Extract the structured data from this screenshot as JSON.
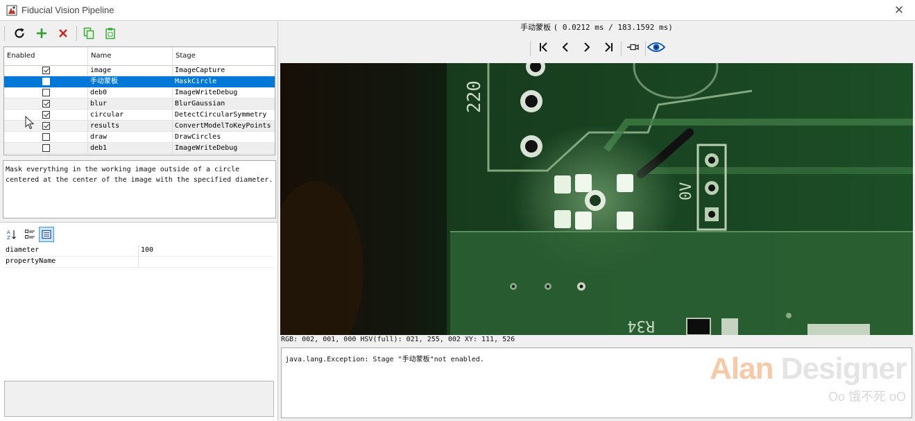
{
  "window": {
    "title": "Fiducial Vision Pipeline",
    "close_glyph": "✕"
  },
  "toolbar": {
    "icons": [
      "refresh-icon",
      "add-icon",
      "delete-icon",
      "copy-icon",
      "paste-icon"
    ]
  },
  "table": {
    "headers": {
      "enabled": "Enabled",
      "name": "Name",
      "stage": "Stage"
    },
    "rows": [
      {
        "enabled": true,
        "name": "image",
        "stage": "ImageCapture"
      },
      {
        "enabled": false,
        "name": "手动蒙板",
        "stage": "MaskCircle"
      },
      {
        "enabled": false,
        "name": "deb0",
        "stage": "ImageWriteDebug"
      },
      {
        "enabled": true,
        "name": "blur",
        "stage": "BlurGaussian"
      },
      {
        "enabled": true,
        "name": "circular",
        "stage": "DetectCircularSymmetry"
      },
      {
        "enabled": true,
        "name": "results",
        "stage": "ConvertModelToKeyPoints"
      },
      {
        "enabled": false,
        "name": "draw",
        "stage": "DrawCircles"
      },
      {
        "enabled": false,
        "name": "deb1",
        "stage": "ImageWriteDebug"
      }
    ],
    "selected_row": 1
  },
  "description": {
    "text": "Mask everything in the working image outside of a circle centered at the center of the image with the specified diameter."
  },
  "properties": {
    "toolbar_icons": [
      "sort-alphabetical-icon",
      "categorized-icon",
      "property-pages-icon"
    ],
    "rows": [
      {
        "key": "diameter",
        "value": "100"
      },
      {
        "key": "propertyName",
        "value": ""
      }
    ]
  },
  "viewer": {
    "stage_title": "手动蒙板",
    "timing": "( 0.0212 ms / 183.1592 ms)",
    "nav_icons": [
      "first-icon",
      "previous-icon",
      "next-icon",
      "last-icon",
      "pin-icon",
      "eye-icon"
    ],
    "pcb_labels": {
      "ref_220": "220",
      "ref_0v": "0V",
      "ref_r34": "R34"
    },
    "pixel_readout": "RGB: 002, 001, 000 HSV(full): 021, 255, 002 XY: 111, 526"
  },
  "console": {
    "message": "java.lang.Exception: Stage \"手动蒙板\"not enabled."
  },
  "watermark": {
    "main_a": "Alan",
    "main_b": "Designer",
    "sub": "Oo 饿不死 oO"
  },
  "colors": {
    "selection": "#0078d7",
    "add_green": "#2ea12e",
    "delete_red": "#d32020",
    "copy_green": "#3aa83a"
  }
}
